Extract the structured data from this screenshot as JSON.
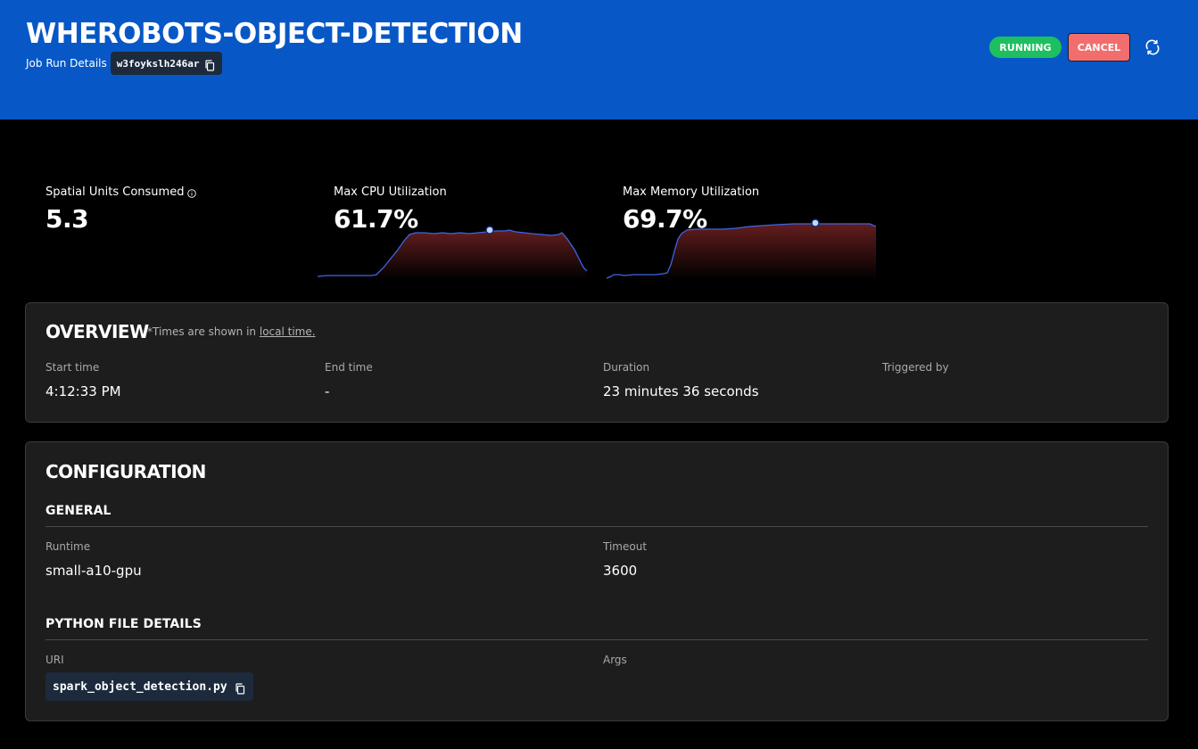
{
  "header": {
    "title": "WHEROBOTS-OBJECT-DETECTION",
    "subtitle": "Job Run Details",
    "run_id": "w3foykslh246ar",
    "status": "RUNNING",
    "cancel_label": "CANCEL",
    "colors": {
      "background": "#0758c6",
      "status": "#1dbf5f",
      "cancel": "#f26d6d"
    }
  },
  "metrics": {
    "spatial_units": {
      "label": "Spatial Units Consumed",
      "value": "5.3"
    },
    "cpu": {
      "label": "Max CPU Utilization",
      "value": "61.7%"
    },
    "memory": {
      "label": "Max Memory Utilization",
      "value": "69.7%"
    }
  },
  "overview": {
    "title": "OVERVIEW",
    "note": "*Times are shown in",
    "note_link": "local time.",
    "fields": [
      {
        "label": "Start time",
        "value": "4:12:33 PM"
      },
      {
        "label": "End time",
        "value": "-"
      },
      {
        "label": "Duration",
        "value": "23 minutes 36 seconds"
      },
      {
        "label": "Triggered by",
        "value": ""
      }
    ]
  },
  "configuration": {
    "title": "CONFIGURATION",
    "general": {
      "title": "GENERAL",
      "runtime_label": "Runtime",
      "runtime_value": "small-a10-gpu",
      "timeout_label": "Timeout",
      "timeout_value": "3600"
    },
    "python": {
      "title": "PYTHON FILE DETAILS",
      "uri_label": "URI",
      "uri_value": "spark_object_detection.py",
      "args_label": "Args"
    }
  }
}
